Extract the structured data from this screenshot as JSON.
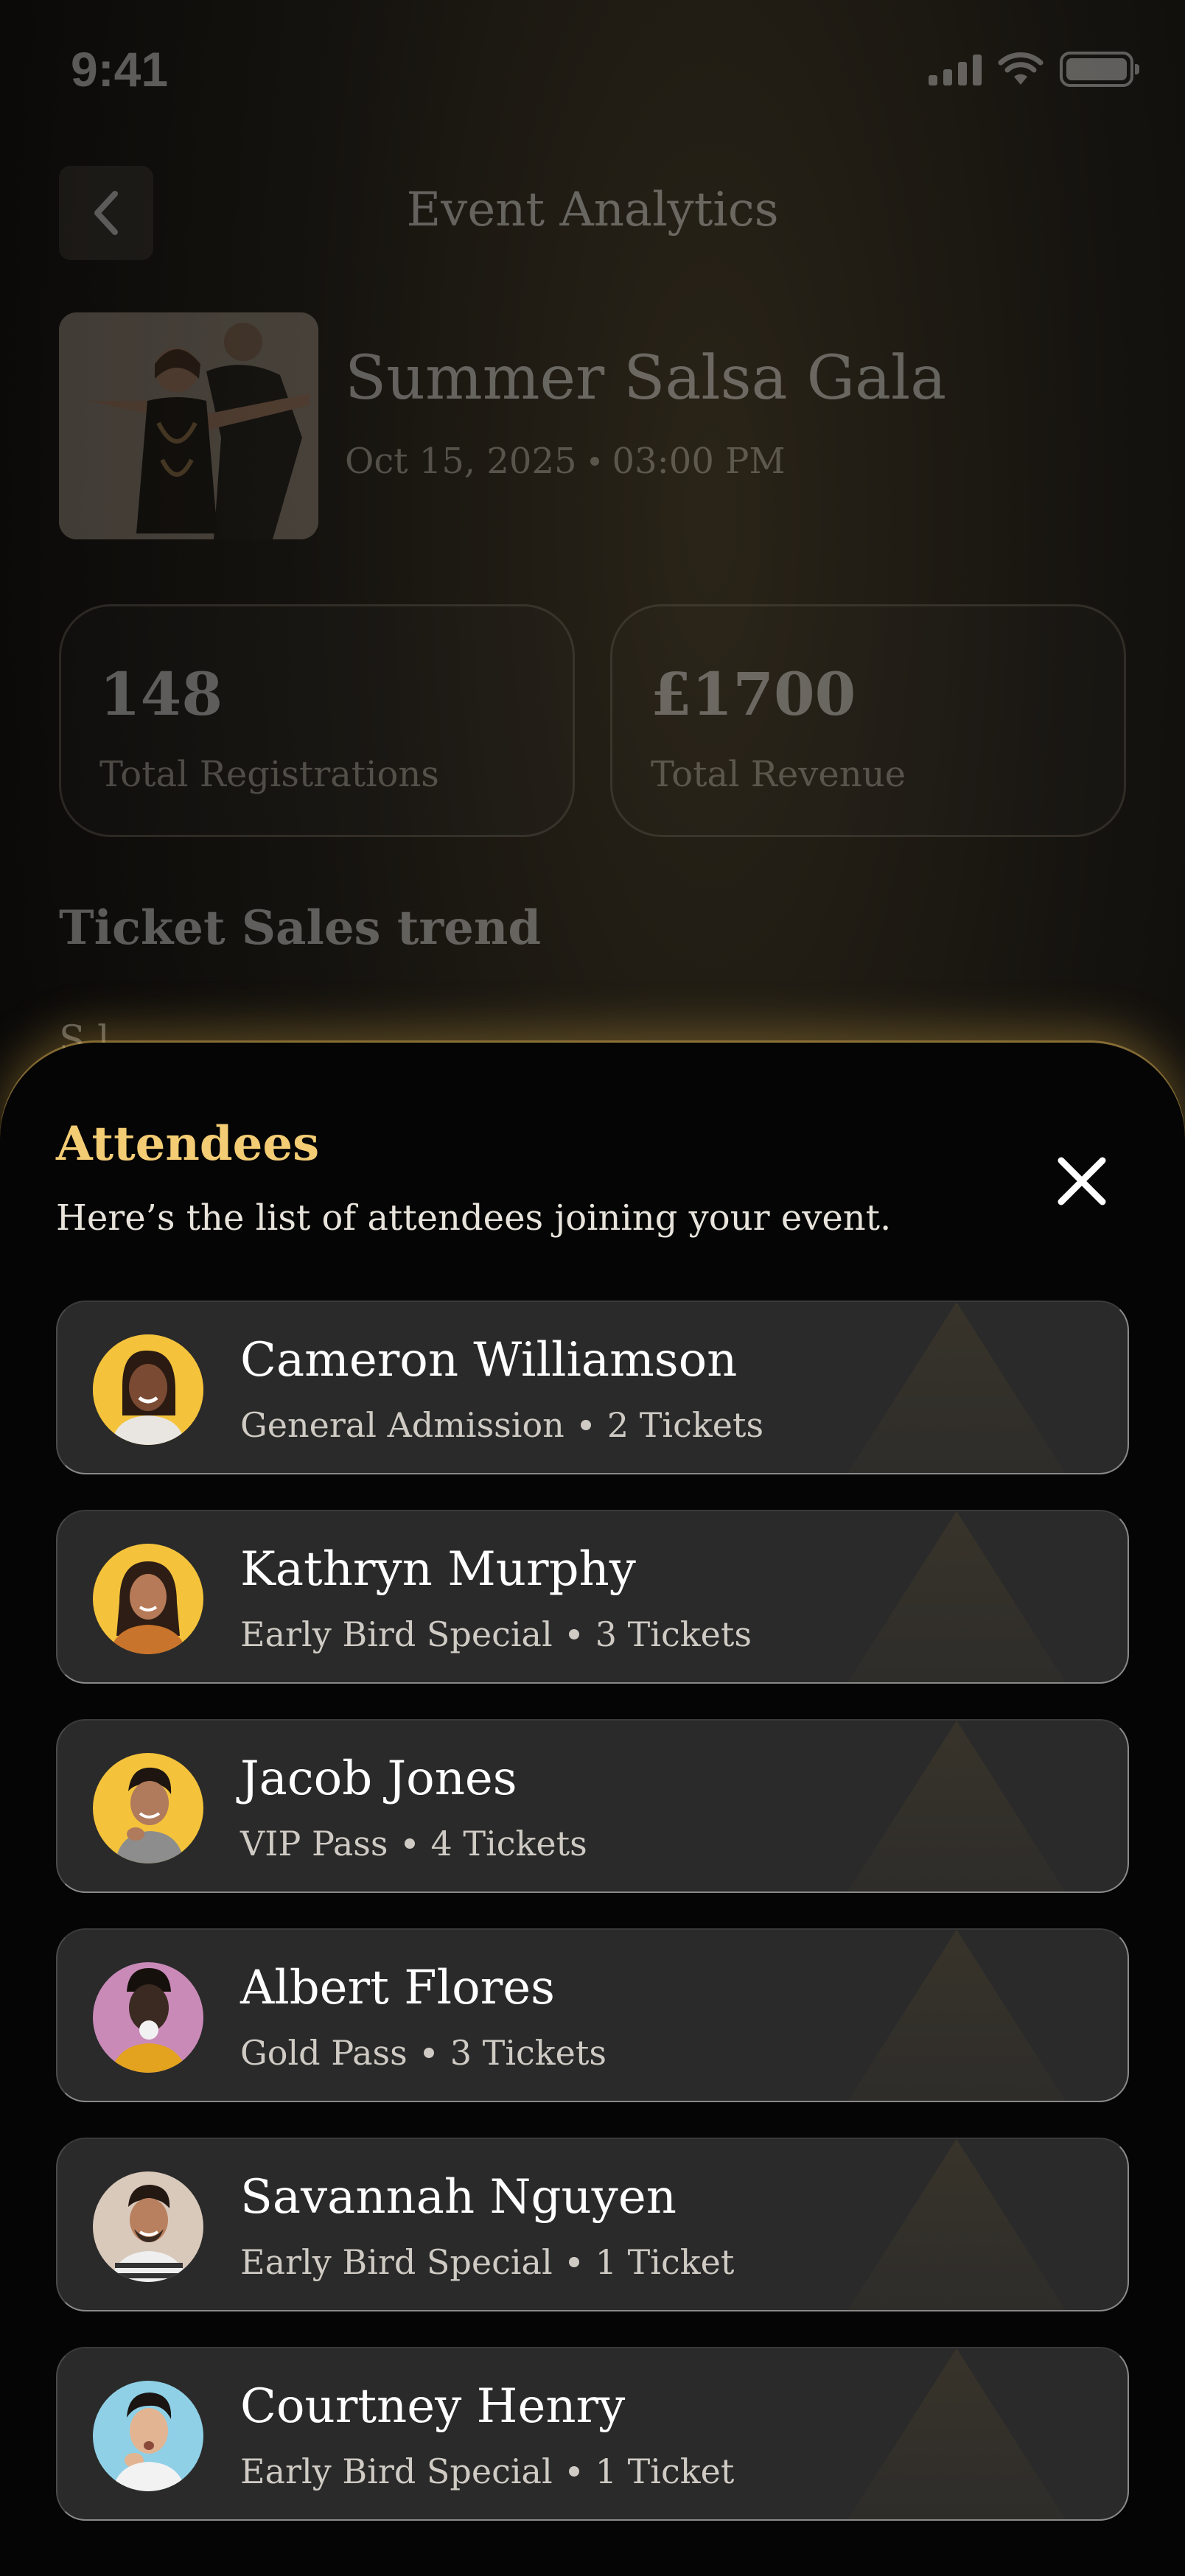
{
  "status_bar": {
    "time": "9:41"
  },
  "header": {
    "title": "Event Analytics"
  },
  "event": {
    "name": "Summer Salsa Gala",
    "date": "Oct 15, 2025",
    "time": "03:00 PM"
  },
  "stats": [
    {
      "value": "148",
      "label": "Total Registrations"
    },
    {
      "value": "£1700",
      "label": "Total Revenue"
    }
  ],
  "trend": {
    "title": "Ticket Sales trend",
    "partial_label": "S l"
  },
  "sheet": {
    "title": "Attendees",
    "subtitle": "Here’s the list of attendees joining your event.",
    "accent_color": "#f3cc74"
  },
  "attendees": [
    {
      "name": "Cameron Williamson",
      "ticket_type": "General Admission",
      "tickets": "2 Tickets",
      "avatar_bg": "#f4c33b"
    },
    {
      "name": "Kathryn Murphy",
      "ticket_type": "Early Bird Special",
      "tickets": "3 Tickets",
      "avatar_bg": "#f4c33b"
    },
    {
      "name": "Jacob Jones",
      "ticket_type": "VIP Pass",
      "tickets": "4 Tickets",
      "avatar_bg": "#f4c33b"
    },
    {
      "name": "Albert Flores",
      "ticket_type": "Gold Pass",
      "tickets": "3 Tickets",
      "avatar_bg": "#c98ab8"
    },
    {
      "name": "Savannah Nguyen",
      "ticket_type": "Early Bird Special",
      "tickets": "1 Ticket",
      "avatar_bg": "#d9c9bb"
    },
    {
      "name": "Courtney Henry",
      "ticket_type": "Early Bird Special",
      "tickets": "1 Ticket",
      "avatar_bg": "#8fd0e6"
    }
  ]
}
